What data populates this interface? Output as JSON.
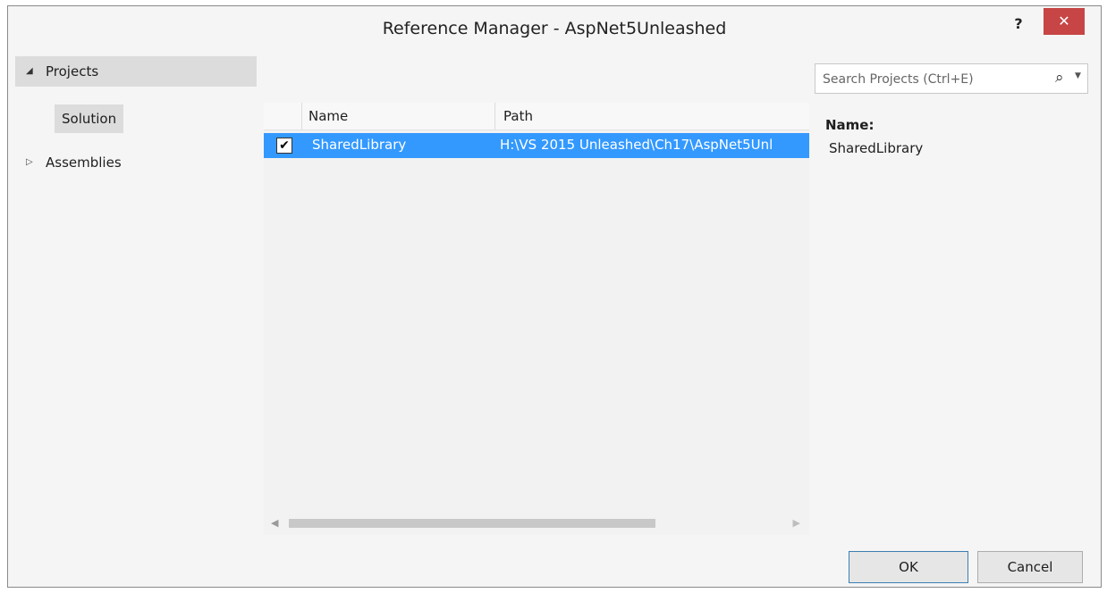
{
  "window": {
    "title": "Reference Manager - AspNet5Unleashed",
    "help_label": "?",
    "close_label": "✕"
  },
  "nav": {
    "projects_label": "Projects",
    "projects_arrow": "◢",
    "solution_label": "Solution",
    "assemblies_label": "Assemblies",
    "assemblies_arrow": "▷"
  },
  "list": {
    "columns": {
      "name": "Name",
      "path": "Path"
    },
    "rows": [
      {
        "checked": true,
        "check_glyph": "✔",
        "name": "SharedLibrary",
        "path": "H:\\VS 2015 Unleashed\\Ch17\\AspNet5Unl"
      }
    ]
  },
  "search": {
    "placeholder": "Search Projects (Ctrl+E)",
    "icon": "search-icon"
  },
  "details": {
    "label": "Name:",
    "value": "SharedLibrary"
  },
  "buttons": {
    "ok": "OK",
    "cancel": "Cancel"
  },
  "colors": {
    "selection": "#3399ff",
    "close": "#c74545"
  }
}
